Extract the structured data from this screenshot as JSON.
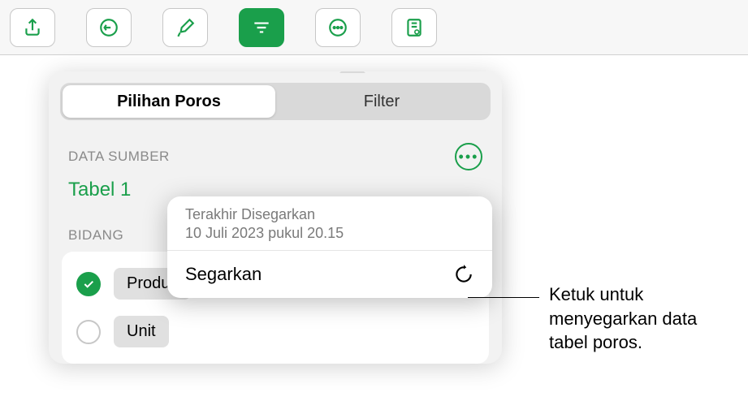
{
  "toolbar": {
    "icons": [
      "share-icon",
      "undo-icon",
      "format-brush-icon",
      "organize-icon",
      "more-icon",
      "preview-icon"
    ]
  },
  "popover": {
    "tabs": {
      "pivot": "Pilihan Poros",
      "filter": "Filter"
    },
    "data_source_label": "DATA SUMBER",
    "table_name": "Tabel 1",
    "fields_label": "BIDANG",
    "fields": [
      {
        "label": "Produk",
        "checked": true
      },
      {
        "label": "Unit",
        "checked": false
      }
    ]
  },
  "refresh": {
    "last_label": "Terakhir Disegarkan",
    "last_date": "10 Juli 2023 pukul 20.15",
    "action": "Segarkan"
  },
  "callout": "Ketuk untuk menyegarkan data tabel poros."
}
